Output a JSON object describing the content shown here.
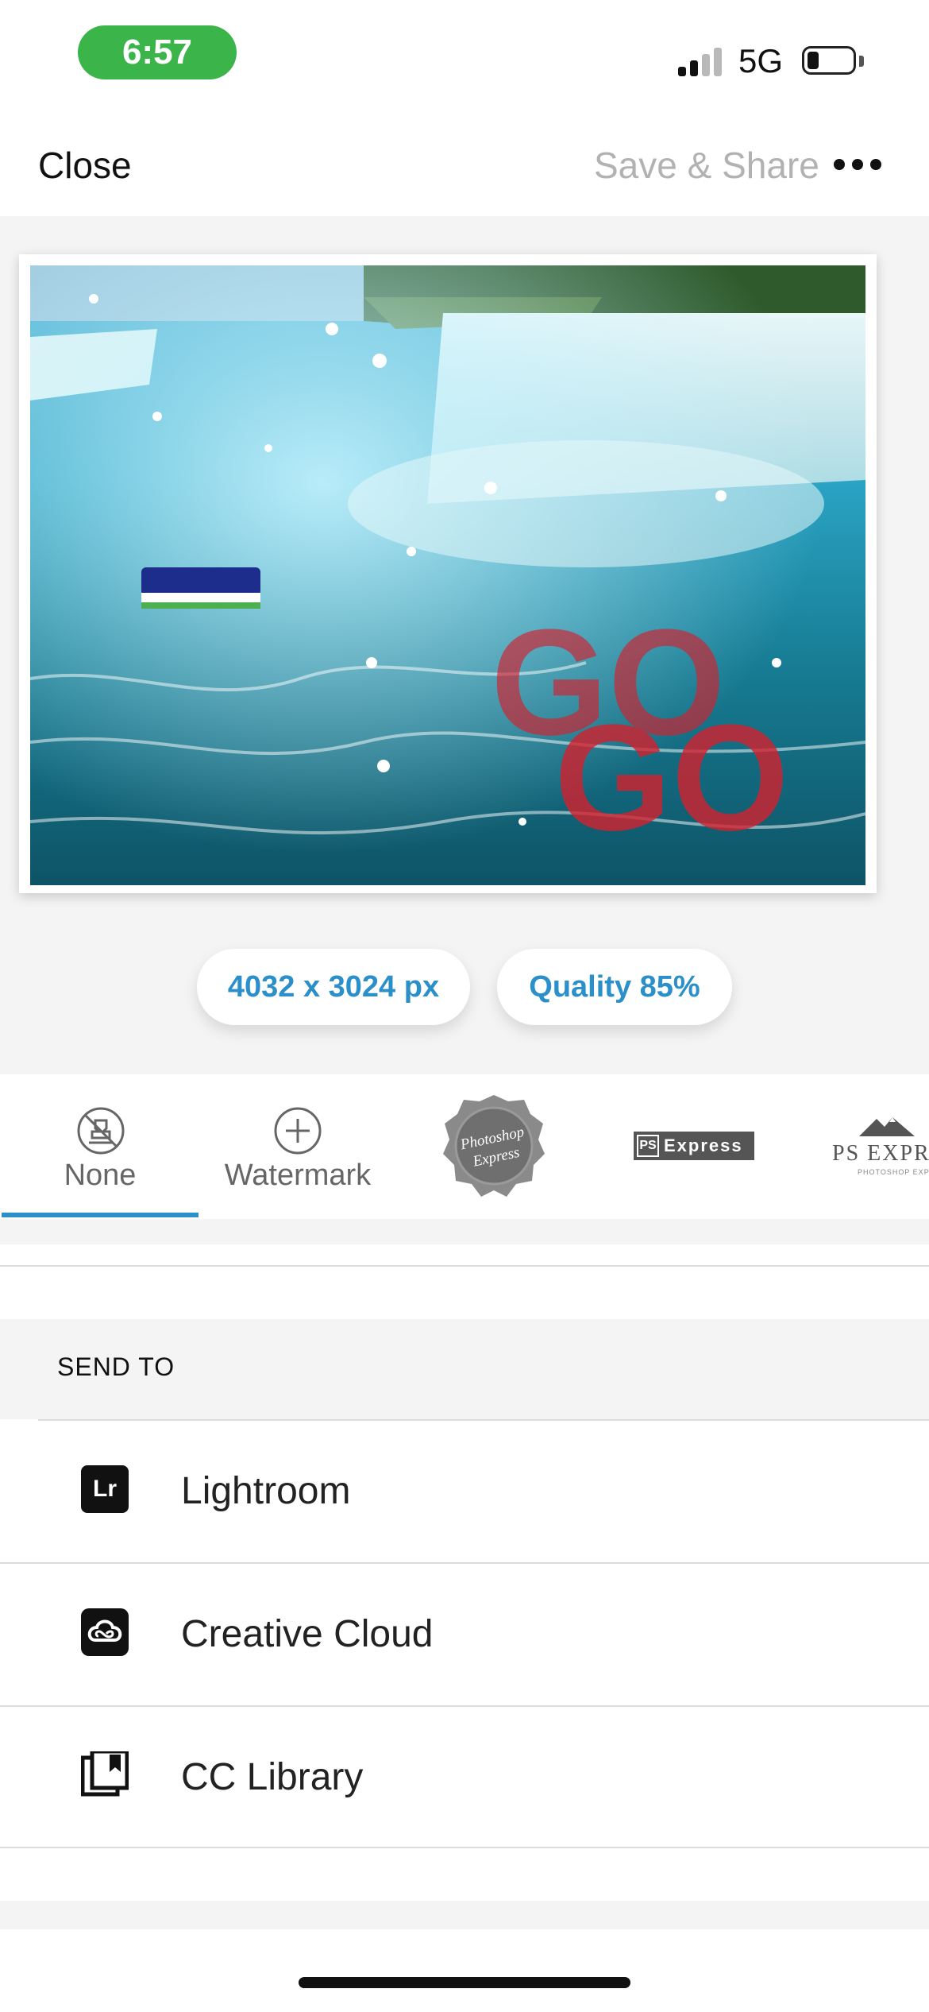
{
  "status_bar": {
    "time": "6:57",
    "network": "5G",
    "time_pill_color": "#3bb44a",
    "icons": [
      "signal-bars-icon",
      "battery-icon"
    ]
  },
  "top_bar": {
    "close_label": "Close",
    "save_share_label": "Save & Share",
    "more_icon": "more-dots-icon"
  },
  "preview": {
    "overlay_text": [
      "GO",
      "GO"
    ]
  },
  "export_settings": {
    "size_label": "4032 x 3024 px",
    "quality_label": "Quality 85%",
    "accent_color": "#2b8fc9"
  },
  "watermarks": {
    "items": [
      {
        "id": "none",
        "label": "None",
        "icon": "stamp-icon",
        "selected": true
      },
      {
        "id": "watermark",
        "label": "Watermark",
        "icon": "plus-circle-icon",
        "selected": false
      },
      {
        "id": "badge",
        "label": "",
        "icon": "photoshop-express-badge",
        "badge_text": [
          "Photoshop",
          "Express"
        ],
        "selected": false
      },
      {
        "id": "ps-express",
        "label": "",
        "icon": "ps-express-logo",
        "logo_text": [
          "PS",
          "Express"
        ],
        "selected": false
      },
      {
        "id": "ps-express-mountain",
        "label": "",
        "icon": "ps-express-mountain-logo",
        "logo_text": [
          "PS EXPRE",
          "PHOTOSHOP EXPRESS"
        ],
        "selected": false
      }
    ]
  },
  "send_to": {
    "header": "SEND TO",
    "destinations": [
      {
        "label": "Lightroom",
        "icon": "lightroom-icon",
        "icon_text": "Lr"
      },
      {
        "label": "Creative Cloud",
        "icon": "creative-cloud-icon"
      },
      {
        "label": "CC Library",
        "icon": "cc-library-icon"
      }
    ]
  }
}
